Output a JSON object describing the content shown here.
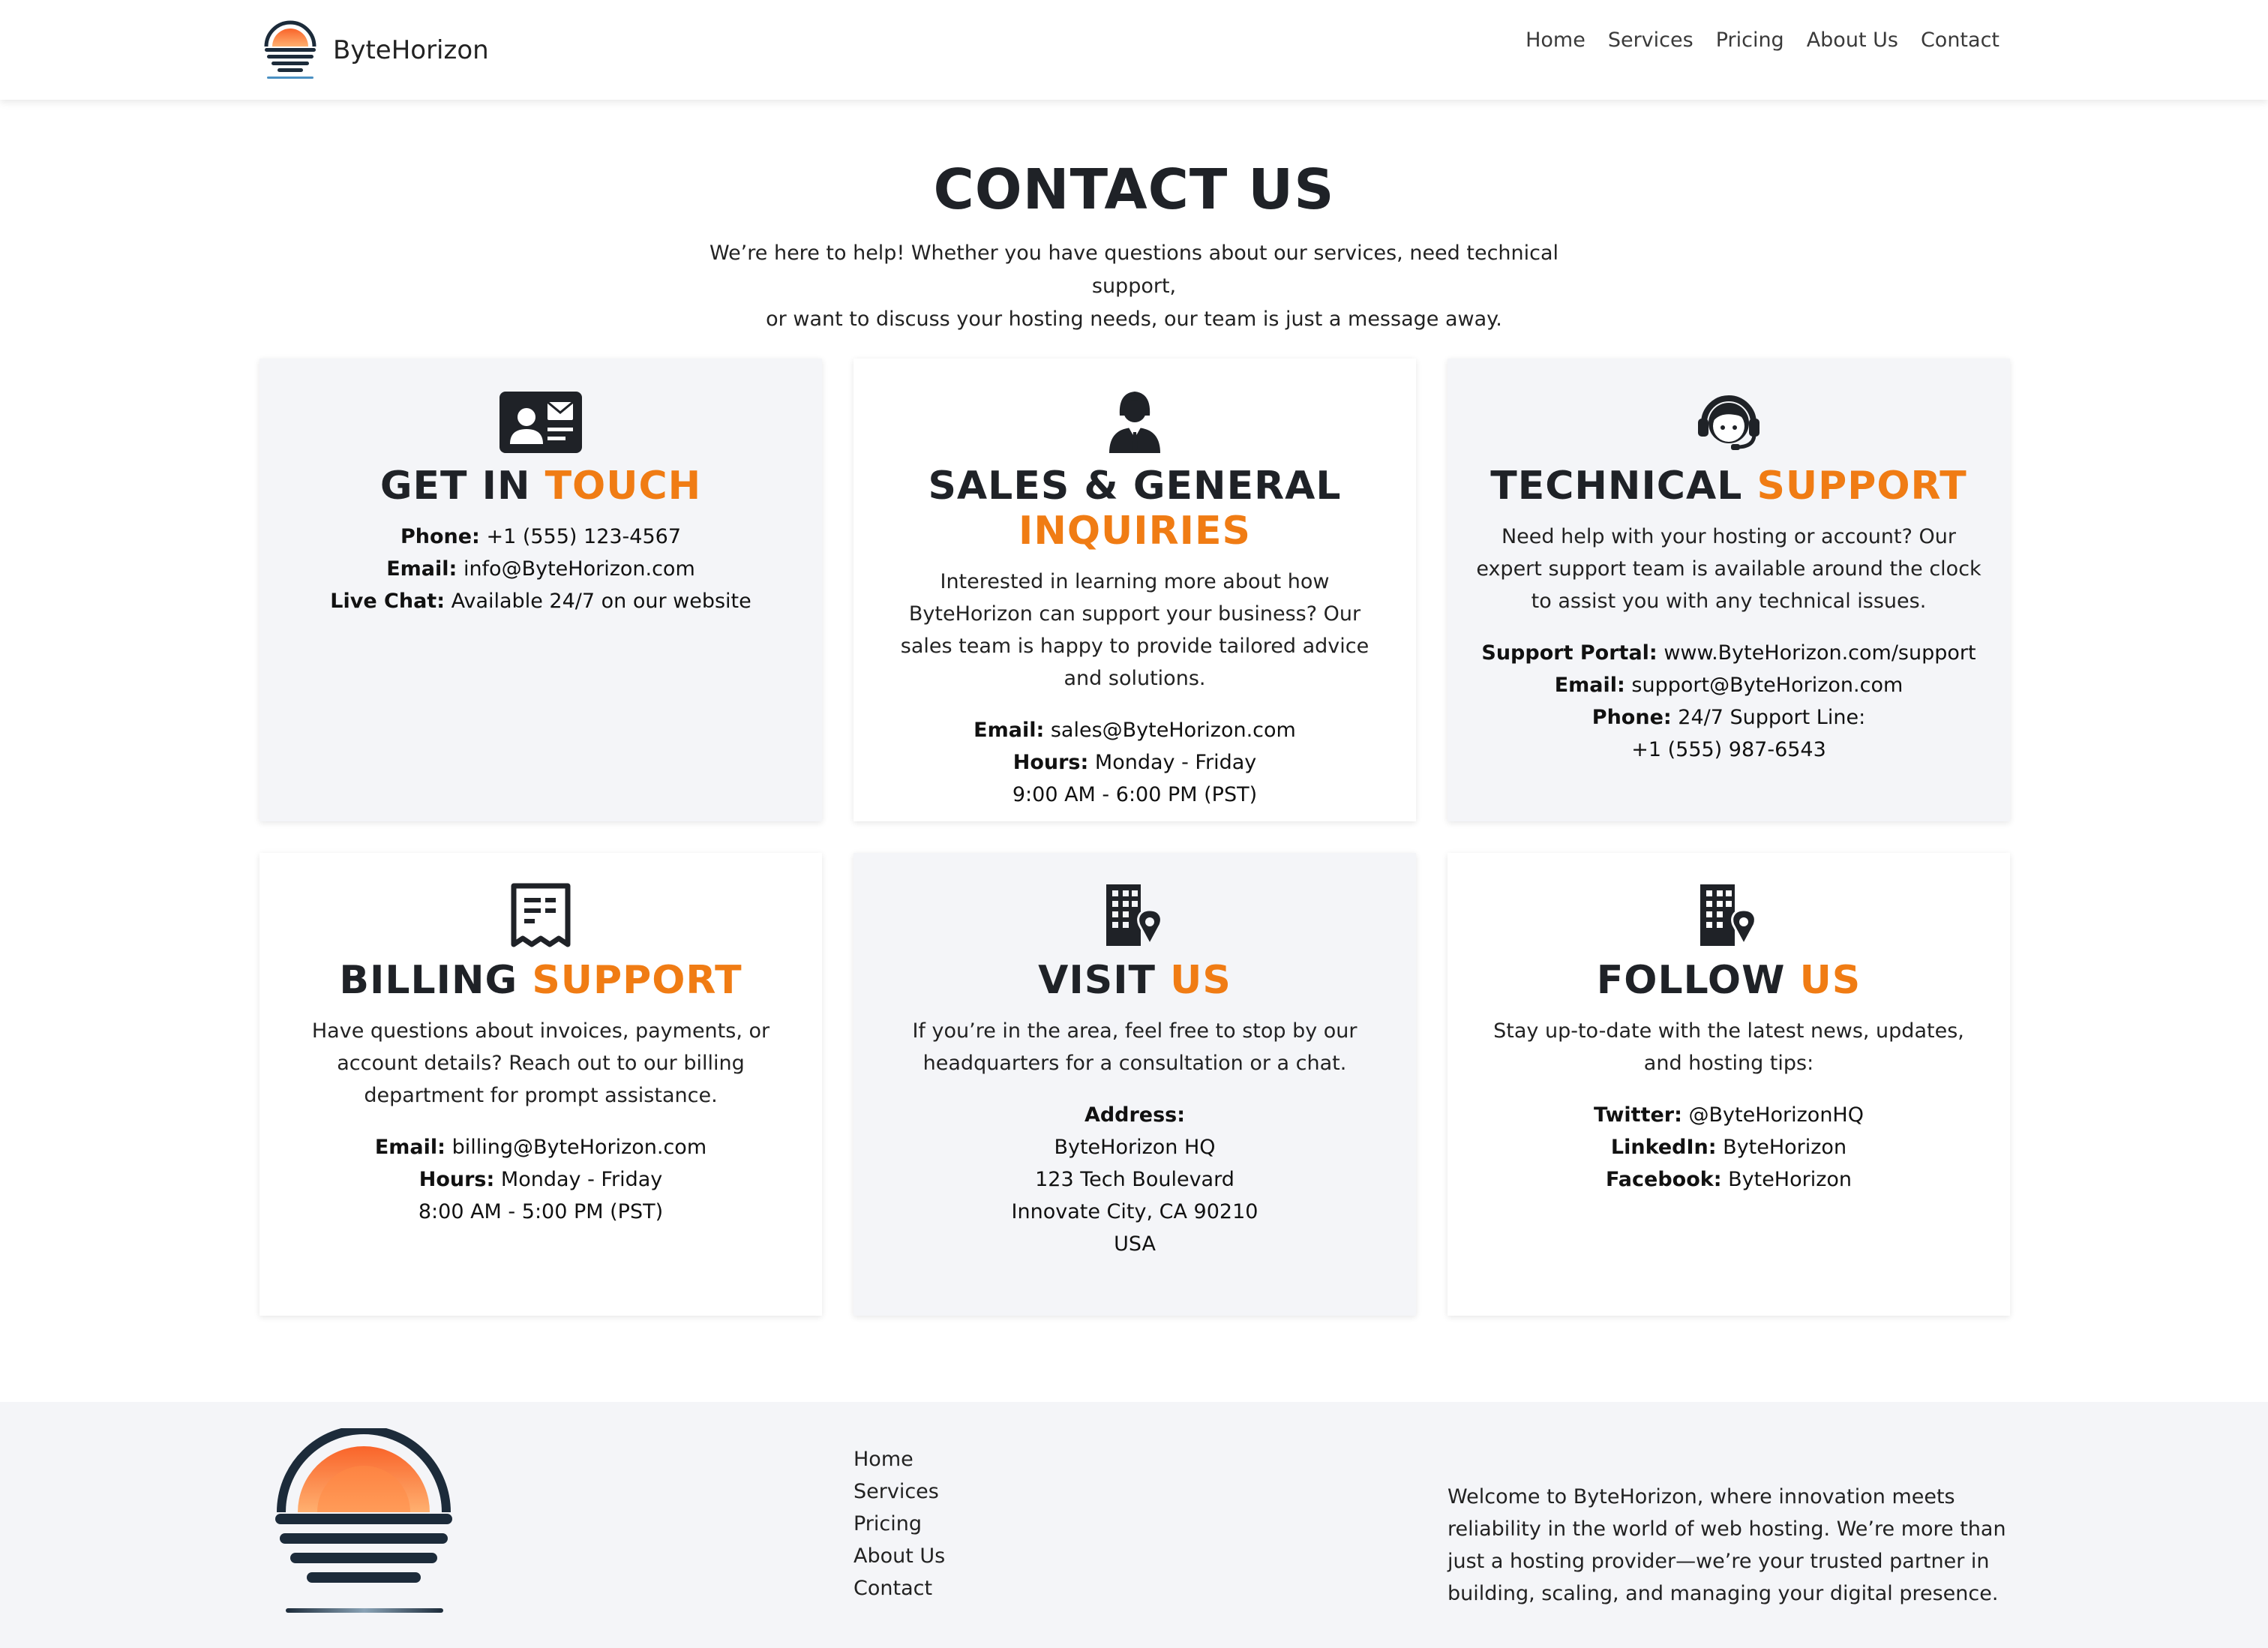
{
  "brand": {
    "name": "ByteHorizon"
  },
  "nav": {
    "items": [
      "Home",
      "Services",
      "Pricing",
      "About Us",
      "Contact"
    ]
  },
  "hero": {
    "title": "CONTACT US",
    "line1": "We’re here to help! Whether you have questions about our services, need technical support,",
    "line2": "or want to discuss your hosting needs, our team is just a message away."
  },
  "cards": [
    {
      "title_main": "GET IN",
      "title_accent": "TOUCH",
      "lines": [
        {
          "label": "Phone:",
          "value": "+1 (555) 123-4567"
        },
        {
          "label": "Email:",
          "value": "info@ByteHorizon.com"
        },
        {
          "label": "Live Chat:",
          "value": "Available 24/7 on our website"
        }
      ]
    },
    {
      "title_main": "SALES & GENERAL",
      "title_accent": "INQUIRIES",
      "desc": "Interested in learning more about how ByteHorizon can support your business? Our sales team is happy to provide tailored advice and solutions.",
      "lines": [
        {
          "label": "Email:",
          "value": "sales@ByteHorizon.com"
        },
        {
          "label": "Hours:",
          "value": "Monday - Friday"
        },
        {
          "label": "",
          "value": "9:00 AM - 6:00 PM (PST)"
        }
      ]
    },
    {
      "title_main": "TECHNICAL",
      "title_accent": "SUPPORT",
      "desc": "Need help with your hosting or account? Our expert support team is available around the clock to assist you with any technical issues.",
      "lines": [
        {
          "label": "Support Portal:",
          "value": "www.ByteHorizon.com/support"
        },
        {
          "label": "Email:",
          "value": "support@ByteHorizon.com"
        },
        {
          "label": "Phone:",
          "value": "24/7 Support Line:"
        },
        {
          "label": "",
          "value": "+1 (555) 987-6543"
        }
      ]
    },
    {
      "title_main": "BILLING",
      "title_accent": "SUPPORT",
      "desc": "Have questions about invoices, payments, or account details? Reach out to our billing department for prompt assistance.",
      "lines": [
        {
          "label": "Email:",
          "value": "billing@ByteHorizon.com"
        },
        {
          "label": "Hours:",
          "value": "Monday - Friday"
        },
        {
          "label": "",
          "value": "8:00 AM - 5:00 PM (PST)"
        }
      ]
    },
    {
      "title_main": "VISIT",
      "title_accent": "US",
      "desc": "If you’re in the area, feel free to stop by our headquarters for a consultation or a chat.",
      "lines": [
        {
          "label": "Address:",
          "value": ""
        },
        {
          "label": "",
          "value": "ByteHorizon HQ"
        },
        {
          "label": "",
          "value": "123 Tech Boulevard"
        },
        {
          "label": "",
          "value": "Innovate City, CA 90210"
        },
        {
          "label": "",
          "value": "USA"
        }
      ]
    },
    {
      "title_main": "FOLLOW",
      "title_accent": "US",
      "desc": "Stay up-to-date with the latest news, updates, and hosting tips:",
      "lines": [
        {
          "label": "Twitter:",
          "value": "@ByteHorizonHQ"
        },
        {
          "label": "LinkedIn:",
          "value": "ByteHorizon"
        },
        {
          "label": "Facebook:",
          "value": "ByteHorizon"
        }
      ]
    }
  ],
  "footer": {
    "links": [
      "Home",
      "Services",
      "Pricing",
      "About Us",
      "Contact"
    ],
    "about": "Welcome to ByteHorizon, where innovation meets reliability in the world of web hosting. We’re more than just a hosting provider—we’re your trusted partner in building, scaling, and managing your digital presence."
  },
  "colors": {
    "accent": "#f07c14",
    "dark": "#1f2227",
    "panel": "#f4f5f8"
  }
}
